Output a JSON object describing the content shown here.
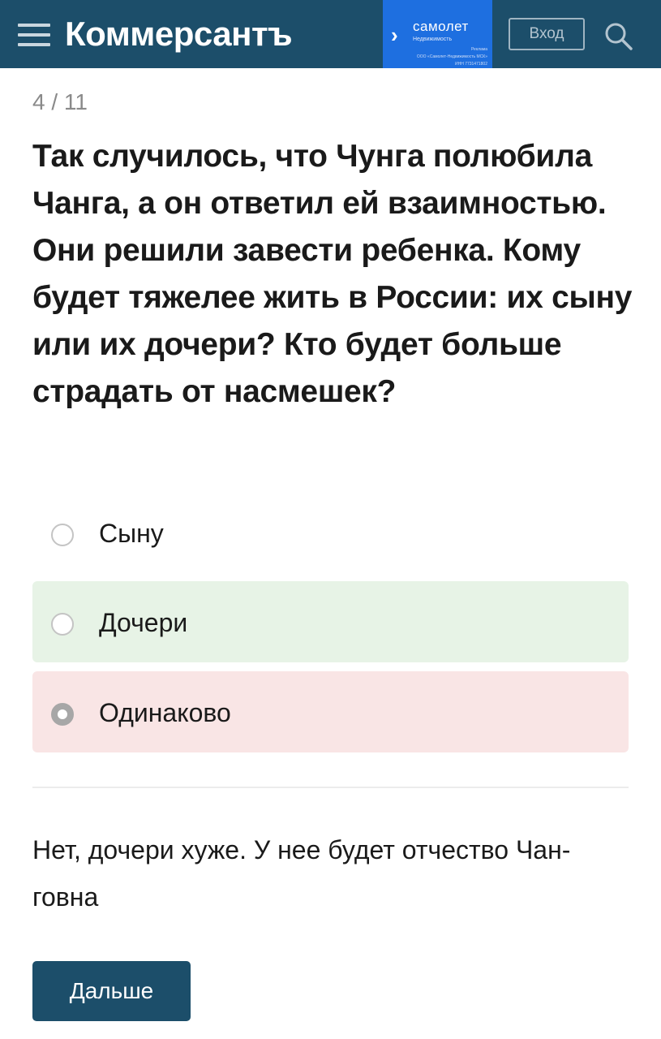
{
  "header": {
    "logo_text": "Коммерсантъ",
    "menu_icon": "hamburger-menu-icon",
    "ad": {
      "title": "самолет",
      "subtitle": "Недвижимость",
      "line1": "Реклама",
      "line2": "ООО «Самолет-Недвижимость МСК»",
      "line3": "ИНН 7731471802"
    },
    "login_label": "Вход",
    "search_icon": "search-icon"
  },
  "quiz": {
    "counter": "4 / 11",
    "question": "Так случилось, что Чунга полюбила Чанга, а он ответил ей взаимностью. Они решили завести ребенка. Кому будет тяжелее жить в России: их сыну или их дочери? Кто будет больше страдать от насмешек?",
    "options": [
      {
        "label": "Сыну",
        "state": "neutral"
      },
      {
        "label": "Дочери",
        "state": "correct"
      },
      {
        "label": "Одинаково",
        "state": "wrong-selected"
      }
    ],
    "answer": "Нет, дочери хуже. У нее будет отчество Чан-говна",
    "next_label": "Дальше"
  },
  "colors": {
    "header_bg": "#1c4e6a",
    "ad_bg": "#1e6fe0",
    "correct_bg": "#e7f3e6",
    "wrong_bg": "#f9e5e5",
    "button_bg": "#1c4e6a"
  }
}
